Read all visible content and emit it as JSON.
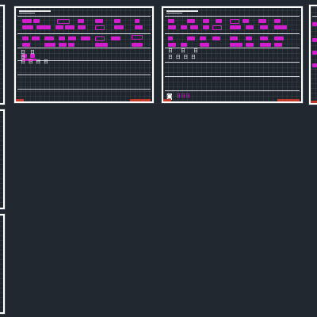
{
  "canvas": {
    "background": "#212830"
  },
  "colors": {
    "sheet_border": "#ffffff",
    "annotation": "#d21ecf",
    "title_tab": "#c23a2a",
    "grid_line": "#c9ced3"
  },
  "sheet_2": {
    "labels": [
      "日",
      "日",
      "日",
      "日 日 日 日"
    ]
  },
  "sheet_3": {
    "labels": [
      "日",
      "日",
      "日",
      "日 日 日 日"
    ],
    "logo_icon": "logo-icon",
    "logo_text": "日日日"
  }
}
